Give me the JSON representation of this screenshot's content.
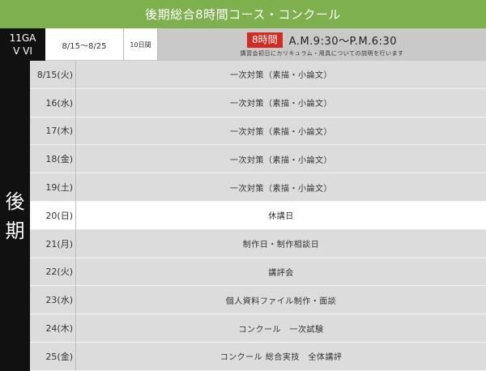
{
  "title": "後期総合8時間コース・コンクール",
  "info": {
    "code_line1": "11GA",
    "code_line2": "V VI",
    "date_range": "8/15〜8/25",
    "day_count": "10日間",
    "hours_badge": "8時間",
    "time_range": "A.M.9:30〜P.M.6:30",
    "note": "講習会初日にカリキュラム・用具についての説明を行います"
  },
  "term_label": [
    "後",
    "期"
  ],
  "schedule": [
    {
      "date": "8/15(火)",
      "content": "一次対策（素描・小論文）",
      "holiday": false
    },
    {
      "date": "16(水)",
      "content": "一次対策（素描・小論文）",
      "holiday": false
    },
    {
      "date": "17(木)",
      "content": "一次対策（素描・小論文）",
      "holiday": false
    },
    {
      "date": "18(金)",
      "content": "一次対策（素描・小論文）",
      "holiday": false
    },
    {
      "date": "19(土)",
      "content": "一次対策（素描・小論文）",
      "holiday": false
    },
    {
      "date": "20(日)",
      "content": "休講日",
      "holiday": true
    },
    {
      "date": "21(月)",
      "content": "制作日・制作相談日",
      "holiday": false
    },
    {
      "date": "22(火)",
      "content": "講評会",
      "holiday": false
    },
    {
      "date": "23(水)",
      "content": "個人資料ファイル制作・面談",
      "holiday": false
    },
    {
      "date": "24(木)",
      "content": "コンクール　一次試験",
      "holiday": false
    },
    {
      "date": "25(金)",
      "content": "コンクール 総合実技　全体講評",
      "holiday": false
    }
  ],
  "colors": {
    "banner": "#7fb04e",
    "dark": "#111111",
    "badge": "#d32b1f",
    "row": "#dcdcdc",
    "header_gray": "#c9c9c9"
  }
}
